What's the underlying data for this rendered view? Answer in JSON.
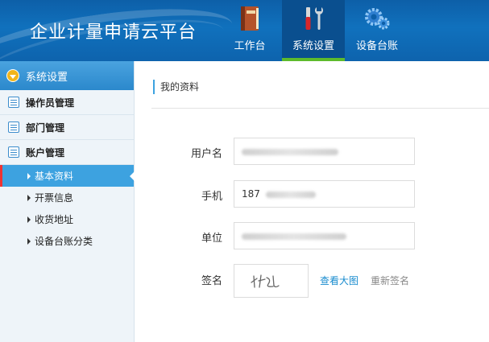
{
  "header": {
    "title": "企业计量申请云平台",
    "nav": [
      {
        "label": "工作台",
        "icon": "book-icon"
      },
      {
        "label": "系统设置",
        "icon": "tools-icon",
        "active": true
      },
      {
        "label": "设备台账",
        "icon": "gears-icon"
      }
    ]
  },
  "sidebar": {
    "header": "系统设置",
    "groups": [
      {
        "label": "操作员管理"
      },
      {
        "label": "部门管理"
      },
      {
        "label": "账户管理"
      }
    ],
    "sub_items": [
      {
        "label": "基本资料",
        "active": true
      },
      {
        "label": "开票信息"
      },
      {
        "label": "收货地址"
      },
      {
        "label": "设备台账分类"
      }
    ]
  },
  "main": {
    "breadcrumb": "我的资料",
    "form": {
      "username_label": "用户名",
      "phone_label": "手机",
      "phone_value": "187",
      "company_label": "单位",
      "signature_label": "签名",
      "view_large_link": "查看大图",
      "resign_link": "重新签名"
    }
  },
  "colors": {
    "header_bg": "#1071bd",
    "active_nav_bar": "#5dbb2c",
    "sidebar_active": "#3da2e0",
    "link": "#1a8ccf"
  }
}
